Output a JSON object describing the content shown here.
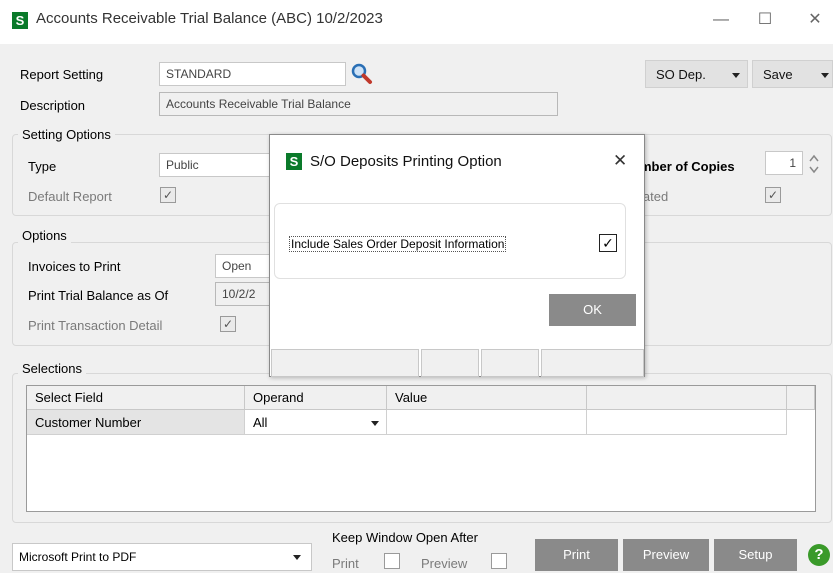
{
  "window": {
    "logo": "S",
    "title": "Accounts Receivable Trial Balance (ABC) 10/2/2023",
    "minimize": "—",
    "maximize": "☐",
    "close": "✕"
  },
  "header": {
    "report_setting_label": "Report Setting",
    "report_setting_value": "STANDARD",
    "description_label": "Description",
    "description_value": "Accounts Receivable Trial Balance",
    "so_dep_button": "SO Dep.",
    "save_button": "Save"
  },
  "setting_options": {
    "title": "Setting Options",
    "type_label": "Type",
    "type_value": "Public",
    "default_report_label": "Default Report",
    "default_report_checked": "✓",
    "number_of_copies_label": "mber of Copies",
    "number_of_copies_value": "1",
    "consolidated_label": "lated",
    "consolidated_checked": "✓"
  },
  "options": {
    "title": "Options",
    "invoices_to_print_label": "Invoices to Print",
    "invoices_to_print_value": "Open",
    "print_trial_balance_label": "Print Trial Balance as Of",
    "print_trial_balance_value": "10/2/2",
    "print_transaction_detail_label": "Print Transaction Detail",
    "print_transaction_detail_checked": "✓"
  },
  "selections": {
    "title": "Selections",
    "columns": [
      "Select Field",
      "Operand",
      "Value",
      ""
    ],
    "rows": [
      {
        "select_field": "Customer Number",
        "operand": "All",
        "value": ""
      }
    ]
  },
  "footer": {
    "printer": "Microsoft Print to PDF",
    "keep_window_open_label": "Keep Window Open After",
    "print_label": "Print",
    "preview_label": "Preview",
    "print_button": "Print",
    "preview_button": "Preview",
    "setup_button": "Setup",
    "help": "?"
  },
  "dialog": {
    "logo": "S",
    "title": "S/O Deposits Printing Option",
    "close": "✕",
    "include_label": "Include Sales Order Deposit Information",
    "include_checked": "✓",
    "ok_button": "OK"
  },
  "colors": {
    "logo_green": "#0a7a2a",
    "button_gray": "#8a8a8a",
    "help_green": "#3a9a2a"
  }
}
